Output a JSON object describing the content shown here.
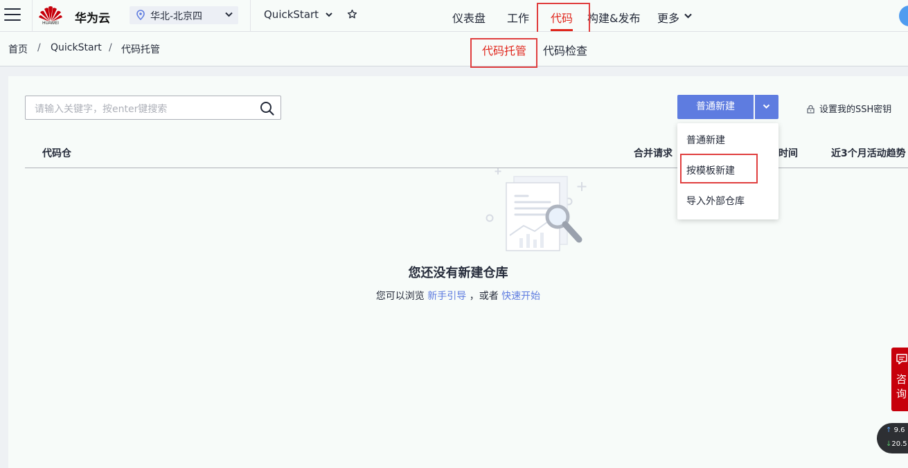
{
  "topbar": {
    "logo_text": "HUAWEI",
    "brand": "华为云",
    "region": "华北-北京四",
    "project": "QuickStart",
    "nav": [
      {
        "label": "仪表盘"
      },
      {
        "label": "工作"
      },
      {
        "label": "代码"
      },
      {
        "label": "构建&发布"
      },
      {
        "label": "更多"
      }
    ],
    "active_nav": "代码"
  },
  "breadcrumb": {
    "items": [
      "首页",
      "QuickStart",
      "代码托管"
    ],
    "separator": "/"
  },
  "subtabs": [
    {
      "label": "代码托管"
    },
    {
      "label": "代码检查"
    }
  ],
  "toolbar": {
    "search_placeholder": "请输入关键字，按enter键搜索",
    "new_button": "普通新建",
    "ssh_label": "设置我的SSH密钥"
  },
  "dropdown": {
    "items": [
      "普通新建",
      "按模板新建",
      "导入外部仓库"
    ]
  },
  "table": {
    "columns": [
      "代码仓",
      "合并请求",
      "时间",
      "近3个月活动趋势"
    ]
  },
  "empty": {
    "title": "您还没有新建仓库",
    "prefix": "您可以浏览",
    "link1": "新手引导",
    "middle": "，或者",
    "link2": "快速开始"
  },
  "consult": {
    "label": "咨询"
  },
  "netspeed": {
    "up": "9.6",
    "down": "20.5"
  },
  "colors": {
    "brand_red": "#c7000b",
    "active_red": "#e0261c",
    "primary_blue": "#5e7ce0",
    "highlight_box": "#e03e3e"
  }
}
